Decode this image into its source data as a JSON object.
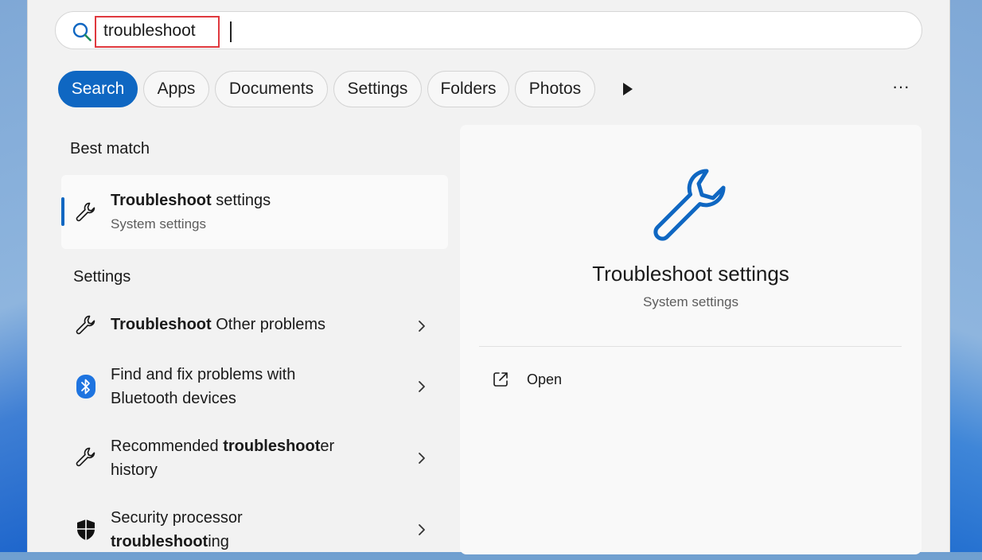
{
  "search": {
    "value": "troubleshoot"
  },
  "filters": [
    {
      "label": "Search",
      "active": true
    },
    {
      "label": "Apps",
      "active": false
    },
    {
      "label": "Documents",
      "active": false
    },
    {
      "label": "Settings",
      "active": false
    },
    {
      "label": "Folders",
      "active": false
    },
    {
      "label": "Photos",
      "active": false
    }
  ],
  "more_filters_icon": "play-arrow-icon",
  "options_label": "···",
  "best_match": {
    "label": "Best match",
    "item": {
      "icon": "wrench-icon",
      "title_bold": "Troubleshoot",
      "title_rest": " settings",
      "subtitle": "System settings"
    }
  },
  "settings_section": {
    "label": "Settings",
    "items": [
      {
        "icon": "wrench-icon",
        "pre": "",
        "bold": "Troubleshoot",
        "post": " Other problems",
        "line2": ""
      },
      {
        "icon": "bluetooth-icon",
        "pre": "Find and fix problems with",
        "bold": "",
        "post": "",
        "line2": "Bluetooth devices"
      },
      {
        "icon": "wrench-icon",
        "pre": "Recommended ",
        "bold": "troubleshoot",
        "post": "er",
        "line2": "history"
      },
      {
        "icon": "shield-icon",
        "pre": "Security processor",
        "bold": "",
        "post": "",
        "line2_bold": "troubleshoot",
        "line2": "ing"
      }
    ]
  },
  "detail": {
    "icon": "wrench-icon",
    "title": "Troubleshoot settings",
    "subtitle": "System settings",
    "actions": [
      {
        "icon": "open-external-icon",
        "label": "Open"
      }
    ]
  },
  "colors": {
    "accent": "#0f67c2",
    "highlight": "#e0393e"
  }
}
